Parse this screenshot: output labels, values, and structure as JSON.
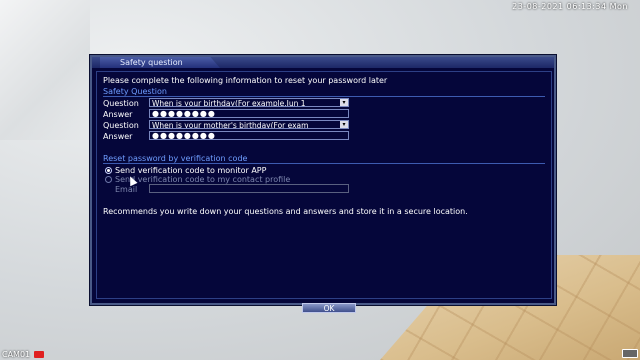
{
  "overlay": {
    "timestamp": "23-08-2021 06:13:34 Mon",
    "camera": "CAM01"
  },
  "dialog": {
    "title": "Safety question",
    "intro": "Please complete the following information to reset your password later",
    "safety_header": "Safety Question",
    "rows": [
      {
        "label": "Question",
        "value": "When is your birthday(For example,Jun 1"
      },
      {
        "label": "Answer",
        "value": "●●●●●●●●"
      },
      {
        "label": "Question",
        "value": "When is your mother's birthday(For exam"
      },
      {
        "label": "Answer",
        "value": "●●●●●●●●"
      }
    ],
    "reset_header": "Reset password by verification code",
    "options": [
      {
        "label": "Send verification code to monitor APP",
        "selected": true
      },
      {
        "label": "Send verification code to my contact profile",
        "selected": false
      }
    ],
    "email_label": "Email",
    "email_value": "",
    "note": "Recommends you write down your questions and answers and store it in a secure location.",
    "ok_label": "OK",
    "dropdown_arrow": "▾"
  }
}
